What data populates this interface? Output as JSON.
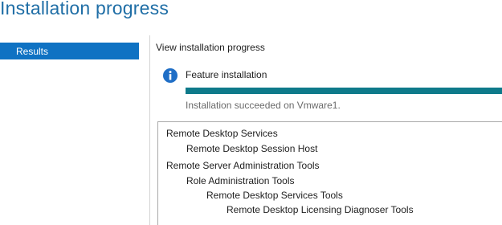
{
  "page": {
    "title": "Installation progress"
  },
  "nav": {
    "items": [
      {
        "label": "Results",
        "selected": true
      }
    ]
  },
  "main": {
    "subhead": "View installation progress",
    "feature": {
      "icon": "info-icon",
      "label": "Feature installation",
      "progress": 1.0,
      "progress_color": "#0e7a8a",
      "status": "Installation succeeded on Vmware1."
    },
    "results": [
      {
        "text": "Remote Desktop Services",
        "level": 0
      },
      {
        "text": "Remote Desktop Session Host",
        "level": 1
      },
      {
        "text": "Remote Server Administration Tools",
        "level": 0
      },
      {
        "text": "Role Administration Tools",
        "level": 1
      },
      {
        "text": "Remote Desktop Services Tools",
        "level": 2
      },
      {
        "text": "Remote Desktop Licensing Diagnoser Tools",
        "level": 3
      }
    ]
  },
  "colors": {
    "accent": "#1f6ea6",
    "nav_selected": "#0f72c3"
  }
}
